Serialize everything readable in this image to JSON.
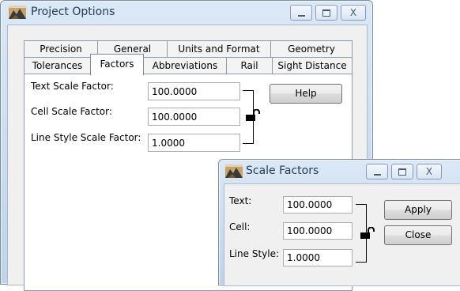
{
  "project_options": {
    "title": "Project Options",
    "tabs_row_back": [
      "Precision",
      "General",
      "Units and Format",
      "Geometry"
    ],
    "tabs_row_front": [
      "Tolerances",
      "Factors",
      "Abbreviations",
      "Rail",
      "Sight Distance"
    ],
    "active_tab": "Factors",
    "fields": {
      "text_scale_label": "Text Scale Factor:",
      "text_scale_value": "100.0000",
      "cell_scale_label": "Cell Scale Factor:",
      "cell_scale_value": "100.0000",
      "line_style_label": "Line Style Scale Factor:",
      "line_style_value": "1.0000"
    },
    "help_label": "Help",
    "close_glyph": "X"
  },
  "scale_factors": {
    "title": "Scale Factors",
    "fields": {
      "text_label": "Text:",
      "text_value": "100.0000",
      "cell_label": "Cell:",
      "cell_value": "100.0000",
      "line_style_label": "Line Style:",
      "line_style_value": "1.0000"
    },
    "apply_label": "Apply",
    "close_label": "Close",
    "close_glyph": "X"
  },
  "icons": {
    "app": "project-options-app-icon",
    "lock": "padlock-unlocked-icon"
  },
  "colors": {
    "title_text": "#1e395b",
    "frame": "#bed3ea",
    "client": "#f0f0f0"
  }
}
